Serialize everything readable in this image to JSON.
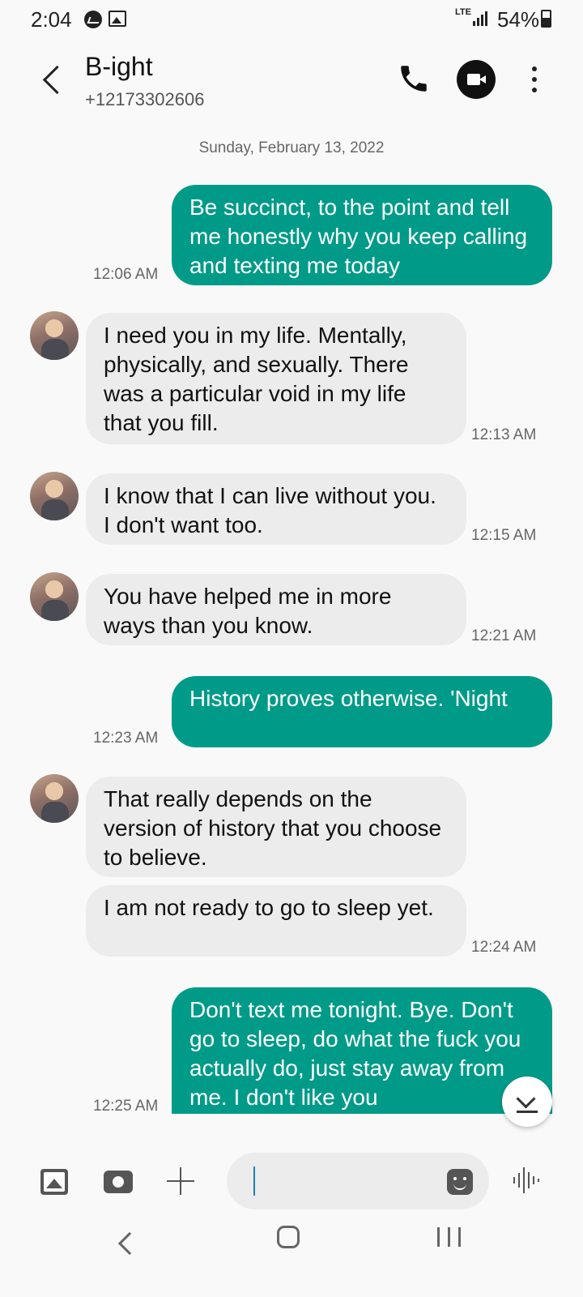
{
  "status_bar": {
    "time": "2:04",
    "network": "LTE",
    "battery": "54%"
  },
  "header": {
    "contact_name": "B-ight",
    "contact_number": "+12173302606"
  },
  "chat": {
    "date_separator": "Sunday, February 13, 2022",
    "messages": [
      {
        "direction": "outgoing",
        "text": "Be succinct, to the point and tell me honestly why you keep calling and texting me today",
        "time": "12:06 AM"
      },
      {
        "direction": "incoming",
        "text": "I need you in my life.  Mentally, physically, and sexually.  There was a particular void in my life that you fill.",
        "time": "12:13 AM"
      },
      {
        "direction": "incoming",
        "text": "I know that I can live without you.  I don't want too.",
        "time": "12:15 AM"
      },
      {
        "direction": "incoming",
        "text": "You have helped me in more ways than you know.",
        "time": "12:21 AM"
      },
      {
        "direction": "outgoing",
        "text": "History proves otherwise. 'Night",
        "time": "12:23 AM"
      },
      {
        "direction": "incoming",
        "text": "That really depends on the version of history that you choose to believe.",
        "time": ""
      },
      {
        "direction": "incoming",
        "text": "I am not ready to go to sleep yet.",
        "time": "12:24 AM"
      },
      {
        "direction": "outgoing",
        "text": "Don't text me tonight. Bye. Don't go to sleep, do what the fuck you actually do, just stay away from me. I don't like you",
        "time": "12:25 AM"
      }
    ]
  },
  "icons": {
    "back": "chevron-left-icon",
    "call": "phone-icon",
    "video": "video-call-icon",
    "more": "more-vertical-icon",
    "scroll": "scroll-to-bottom-icon",
    "gallery": "gallery-icon",
    "camera": "camera-icon",
    "add": "plus-icon",
    "sticker": "sticker-icon",
    "voice": "voice-wave-icon"
  },
  "colors": {
    "outgoing_bubble": "#009b88",
    "incoming_bubble": "#ececec",
    "background": "#f9f9f9"
  }
}
